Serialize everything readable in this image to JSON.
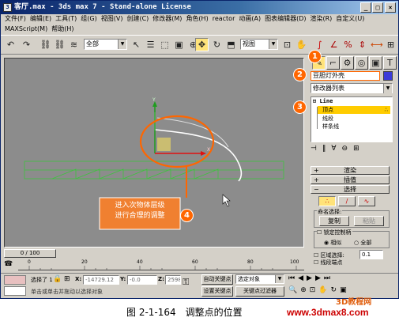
{
  "window": {
    "title": "客厅.max - 3ds max 7 - Stand-alone License",
    "min": "_",
    "max": "□",
    "close": "×"
  },
  "menu": [
    "文件(F)",
    "编辑(E)",
    "工具(T)",
    "组(G)",
    "视图(V)",
    "创建(C)",
    "修改器(M)",
    "角色(H)",
    "reactor",
    "动画(A)",
    "图表编辑器(D)",
    "渲染(R)",
    "自定义(U)",
    "MAXScript(M)",
    "帮助(H)"
  ],
  "toolbar": {
    "selection_filter": "全部",
    "ref_coord": "视图"
  },
  "viewport": {
    "label": "进入次物体层级\n进行合理的调整"
  },
  "command_panel": {
    "object_name": "豆胆灯外壳",
    "modifier_list": "修改器列表",
    "stack": {
      "root": "Line",
      "items": [
        "顶点",
        "线段",
        "样条线"
      ]
    },
    "rollouts": [
      "渲染",
      "插值",
      "选择"
    ],
    "named_selection": {
      "label": "命名选择:",
      "copy": "复制",
      "paste": "粘贴"
    },
    "lock_handles": "锁定控制柄",
    "similar": "相似",
    "all": "全部",
    "area_select": "区域选择:",
    "area_value": "0.1",
    "segment_end": "线段端点"
  },
  "markers": [
    "1",
    "2",
    "3",
    "4"
  ],
  "timeline": {
    "frame": "0 / 100",
    "ticks": [
      "0",
      "20",
      "40",
      "60",
      "80",
      "100"
    ]
  },
  "status": {
    "selection": "选择了 1",
    "x_label": "X:",
    "x": "-14729.12",
    "y_label": "Y:",
    "y": "-0.0",
    "z_label": "Z:",
    "z": "2598",
    "prompt": "单击或单击并拖动以选择对象",
    "auto_key": "自动关键点",
    "set_key": "设置关键点",
    "key_filter": "关键点过滤器",
    "selected_object": "选定对象"
  },
  "caption": {
    "figure": "图 2-1-164　调整点的位置",
    "website": "www.3dmax8.com",
    "logo_text": "3D教程网"
  },
  "colors": {
    "accent": "#ff6600",
    "title_blue": "#0a246a",
    "website_red": "#cc0000",
    "highlight_yellow": "#ffcc00"
  }
}
